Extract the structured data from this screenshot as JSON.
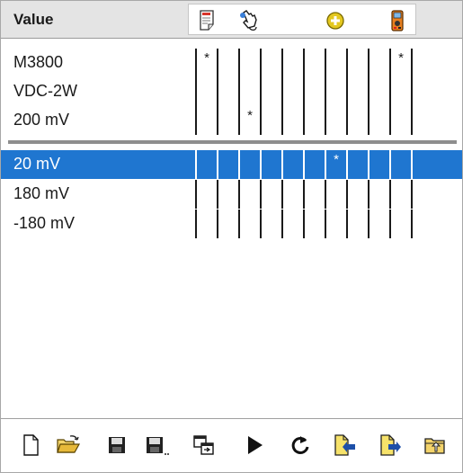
{
  "header": {
    "title": "Value",
    "icons": [
      "notepad-icon",
      "hand-pointer-icon",
      "add-circle-icon",
      "multimeter-icon"
    ]
  },
  "rows": [
    {
      "value": "M3800",
      "marks": [
        {
          "col": 0,
          "text": "*"
        },
        {
          "col": 9,
          "text": "*"
        }
      ],
      "selected": false
    },
    {
      "value": "VDC-2W",
      "marks": [],
      "selected": false
    },
    {
      "value": "200 mV",
      "marks": [
        {
          "col": 2,
          "text": "*"
        }
      ],
      "selected": false
    },
    {
      "value": "20 mV",
      "marks": [
        {
          "col": 6,
          "text": "*"
        }
      ],
      "selected": true
    },
    {
      "value": "180 mV",
      "marks": [],
      "selected": false
    },
    {
      "value": "-180 mV",
      "marks": [],
      "selected": false
    }
  ],
  "toolbar": [
    "new-file-icon",
    "open-folder-icon",
    "save-icon",
    "save-as-icon",
    "copy-window-icon",
    "play-icon",
    "refresh-icon",
    "import-icon",
    "export-icon",
    "upload-folder-icon"
  ],
  "colors": {
    "selection": "#1f76d0",
    "header_bg": "#e4e4e4"
  }
}
